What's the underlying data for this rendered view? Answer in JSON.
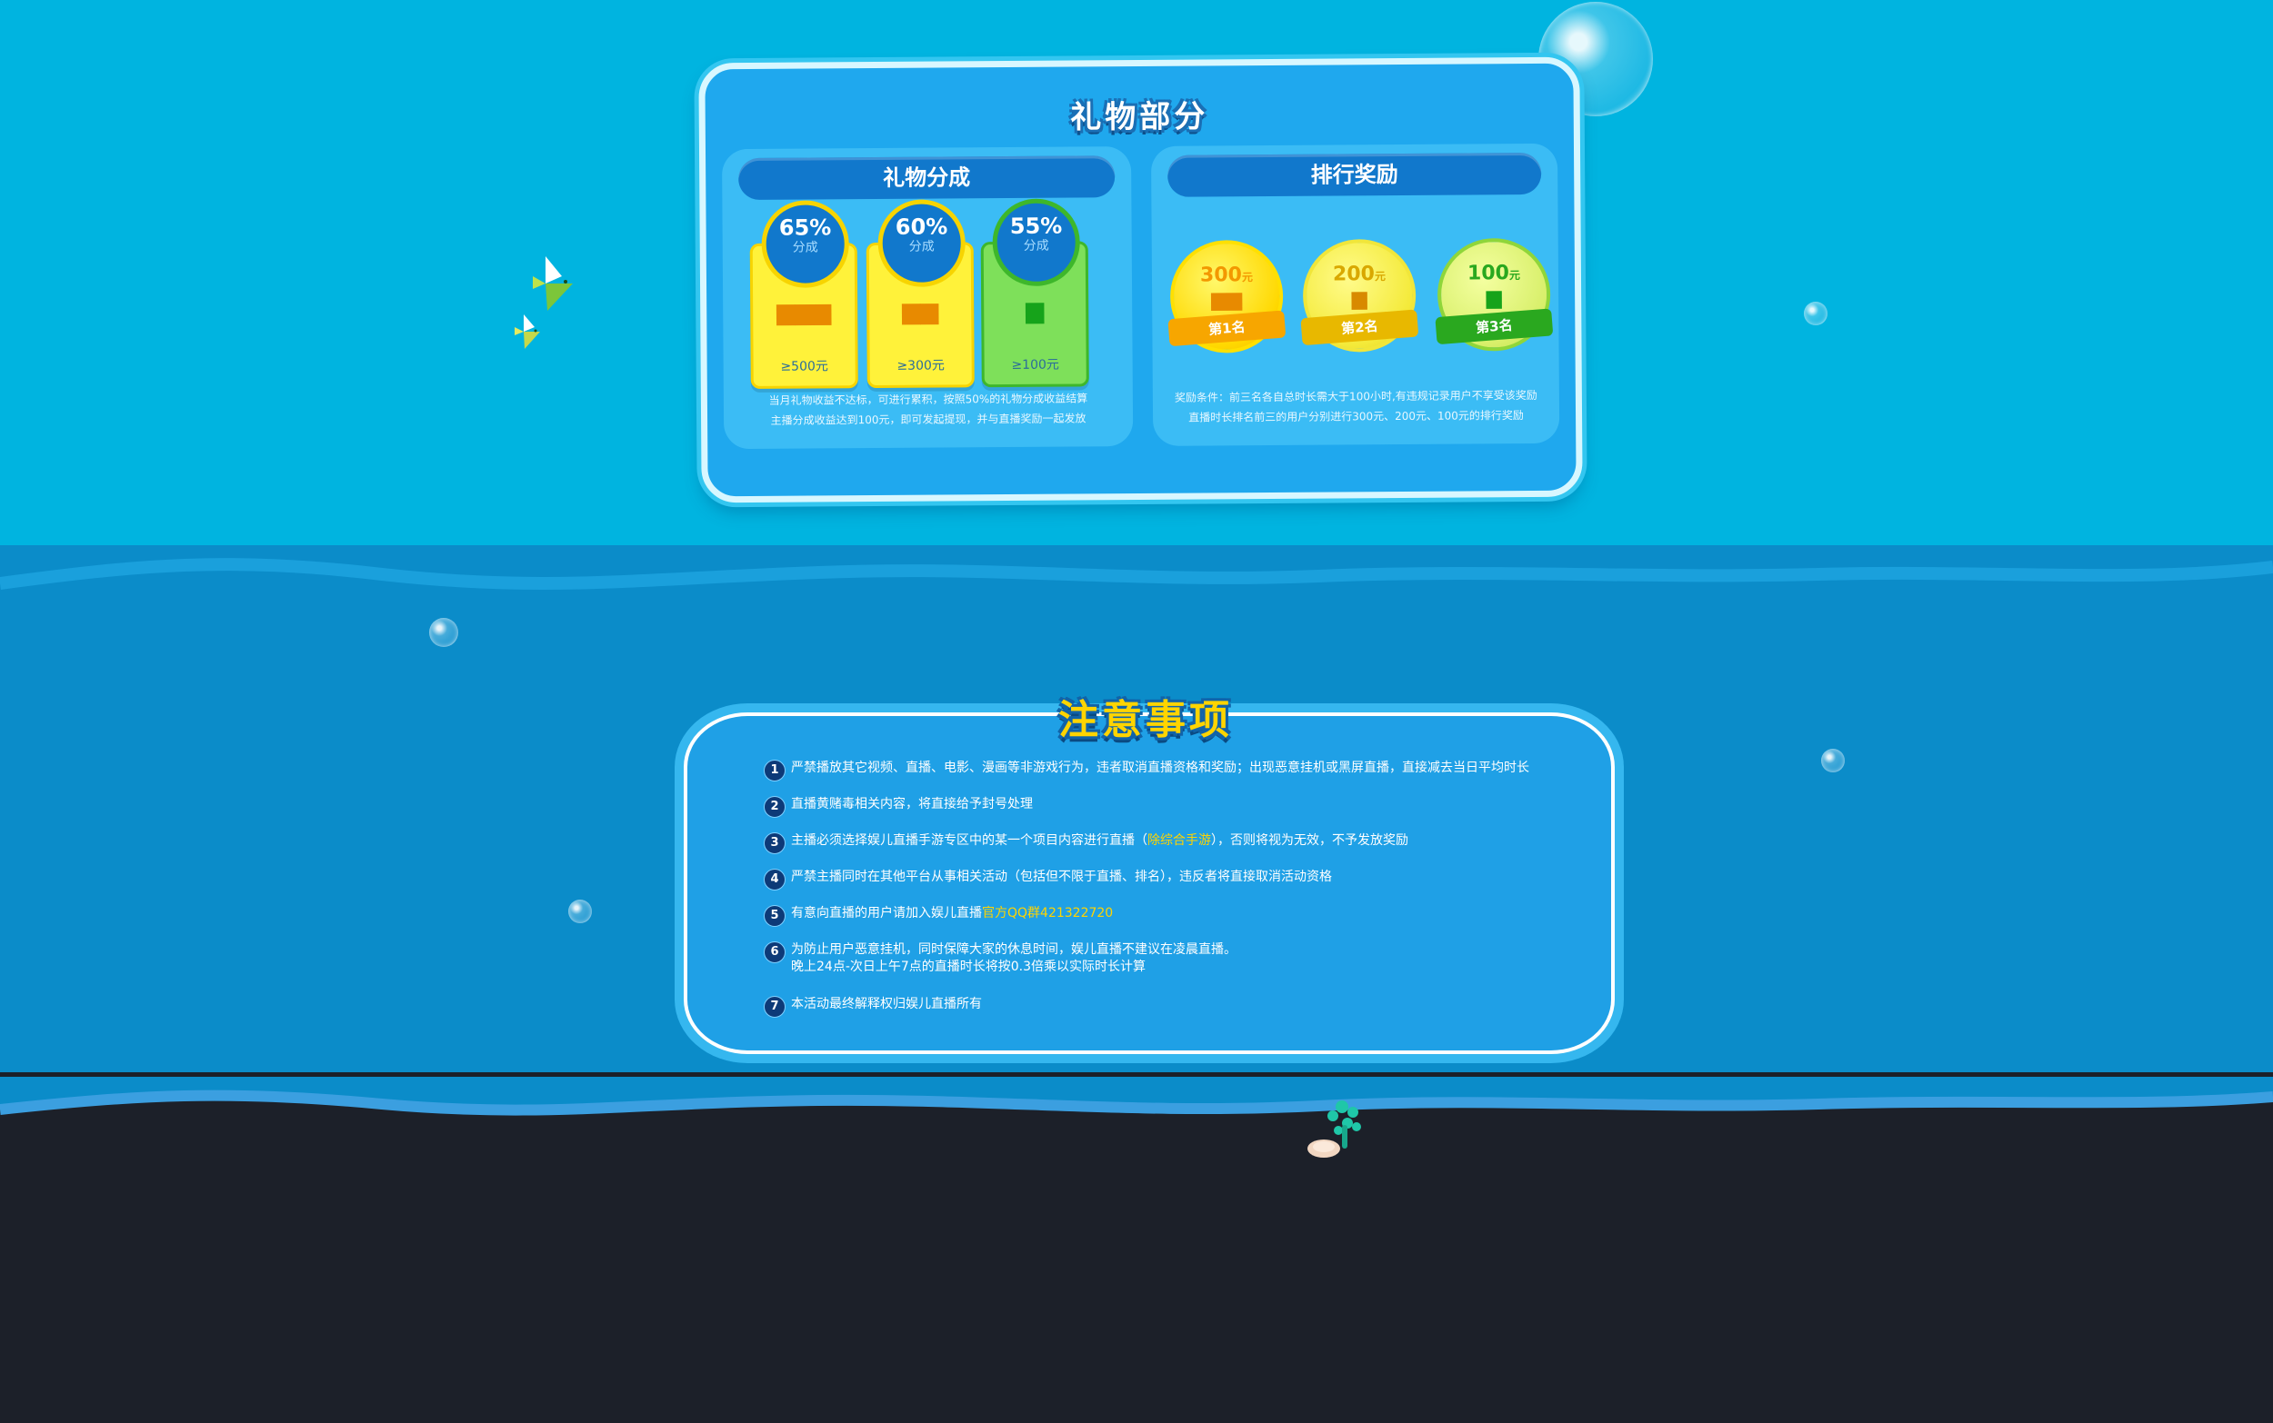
{
  "gift_section": {
    "title": "礼物部分",
    "share": {
      "heading": "礼物分成",
      "tiers": [
        {
          "percent": "65%",
          "label": "分成",
          "threshold": "≥500元",
          "color": "yellow"
        },
        {
          "percent": "60%",
          "label": "分成",
          "threshold": "≥300元",
          "color": "yellow"
        },
        {
          "percent": "55%",
          "label": "分成",
          "threshold": "≥100元",
          "color": "green"
        }
      ],
      "note_line1": "当月礼物收益不达标，可进行累积，按照50%的礼物分成收益结算",
      "note_line2": "主播分成收益达到100元，即可发起提现，并与直播奖励一起发放"
    },
    "ranking": {
      "heading": "排行奖励",
      "prizes": [
        {
          "amount": "300",
          "unit": "元",
          "rank": "第1名",
          "color": "#f7a600"
        },
        {
          "amount": "200",
          "unit": "元",
          "rank": "第2名",
          "color": "#e8b800"
        },
        {
          "amount": "100",
          "unit": "元",
          "rank": "第3名",
          "color": "#2aa81f"
        }
      ],
      "note_line1": "奖励条件：前三名各自总时长需大于100小时,有违规记录用户不享受该奖励",
      "note_line2": "直播时长排名前三的用户分别进行300元、200元、100元的排行奖励"
    }
  },
  "notice_section": {
    "title": "注意事项",
    "rules": [
      {
        "num": "1",
        "text": "严禁播放其它视频、直播、电影、漫画等非游戏行为，违者取消直播资格和奖励；出现恶意挂机或黑屏直播，直接减去当日平均时长"
      },
      {
        "num": "2",
        "text": "直播黄赌毒相关内容，将直接给予封号处理"
      },
      {
        "num": "3",
        "text_before": "主播必须选择娱儿直播手游专区中的某一个项目内容进行直播（",
        "highlight": "除综合手游",
        "text_after": "），否则将视为无效，不予发放奖励"
      },
      {
        "num": "4",
        "text": "严禁主播同时在其他平台从事相关活动（包括但不限于直播、排名），违反者将直接取消活动资格"
      },
      {
        "num": "5",
        "text_before": "有意向直播的用户请加入娱儿直播",
        "highlight": "官方QQ群421322720",
        "text_after": ""
      },
      {
        "num": "6",
        "text": "为防止用户恶意挂机，同时保障大家的休息时间，娱儿直播不建议在凌晨直播。",
        "text2": "晚上24点-次日上午7点的直播时长将按0.3倍乘以实际时长计算"
      },
      {
        "num": "7",
        "text": "本活动最终解释权归娱儿直播所有"
      }
    ]
  },
  "icons": [
    "treasure-chest-icon",
    "bubble-icon",
    "fish-icon",
    "coral-icon",
    "shell-icon"
  ],
  "colors": {
    "sky": "#00b4e0",
    "sea": "#0b8cc9",
    "floor": "#1c2029",
    "highlight": "#ffd400"
  }
}
